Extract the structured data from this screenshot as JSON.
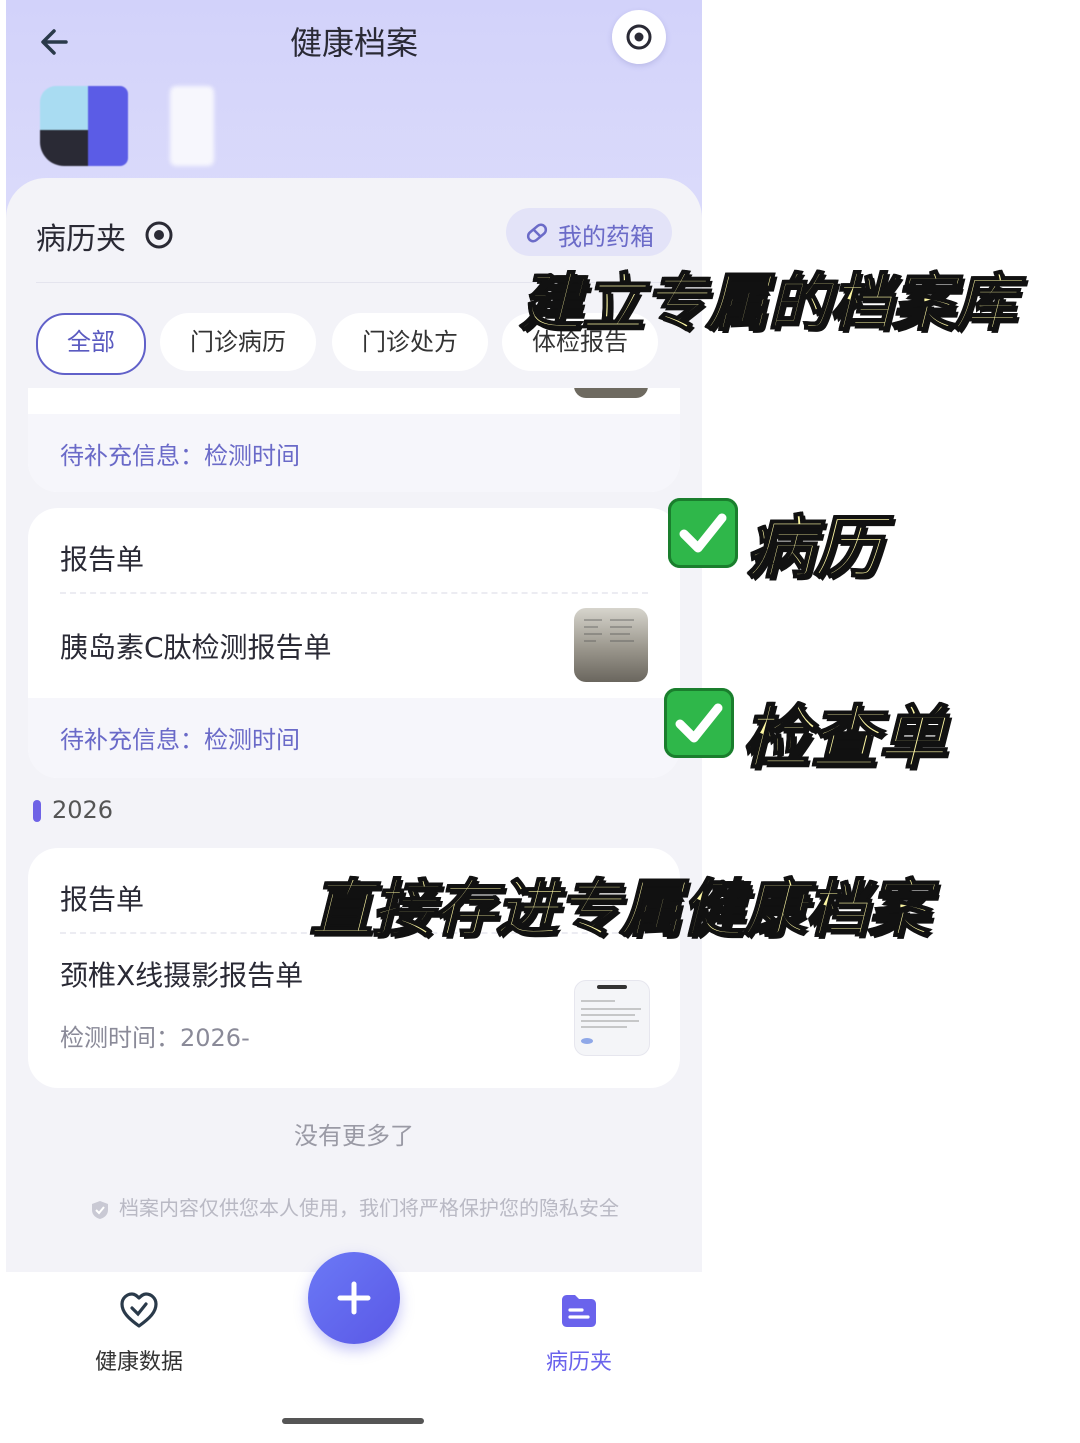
{
  "header": {
    "title": "健康档案"
  },
  "folder": {
    "title": "病历夹",
    "medbox_label": "我的药箱"
  },
  "filters": [
    "全部",
    "门诊病历",
    "门诊处方",
    "体检报告"
  ],
  "card1": {
    "pending": "待补充信息：检测时间"
  },
  "card2": {
    "category": "报告单",
    "item_title": "胰岛素C肽检测报告单",
    "pending": "待补充信息：检测时间"
  },
  "year_group": {
    "label": "2026"
  },
  "card3": {
    "category": "报告单",
    "item_title": "颈椎X线摄影报告单",
    "detect_time": "检测时间：2026-"
  },
  "list_end": "没有更多了",
  "privacy_note": "档案内容仅供您本人使用，我们将严格保护您的隐私安全",
  "tabbar": {
    "left_label": "健康数据",
    "right_label": "病历夹"
  },
  "overlay": {
    "headline": "建立专属的档案库",
    "check1": "病历",
    "check2": "检查单",
    "bottom": "直接存进专属健康档案"
  },
  "colors": {
    "accent": "#6161c9",
    "header_bg": "#d2d2fa",
    "fab": "#5a58e6",
    "overlay_text": "#fdf7a3",
    "check_green": "#2fb74a"
  }
}
